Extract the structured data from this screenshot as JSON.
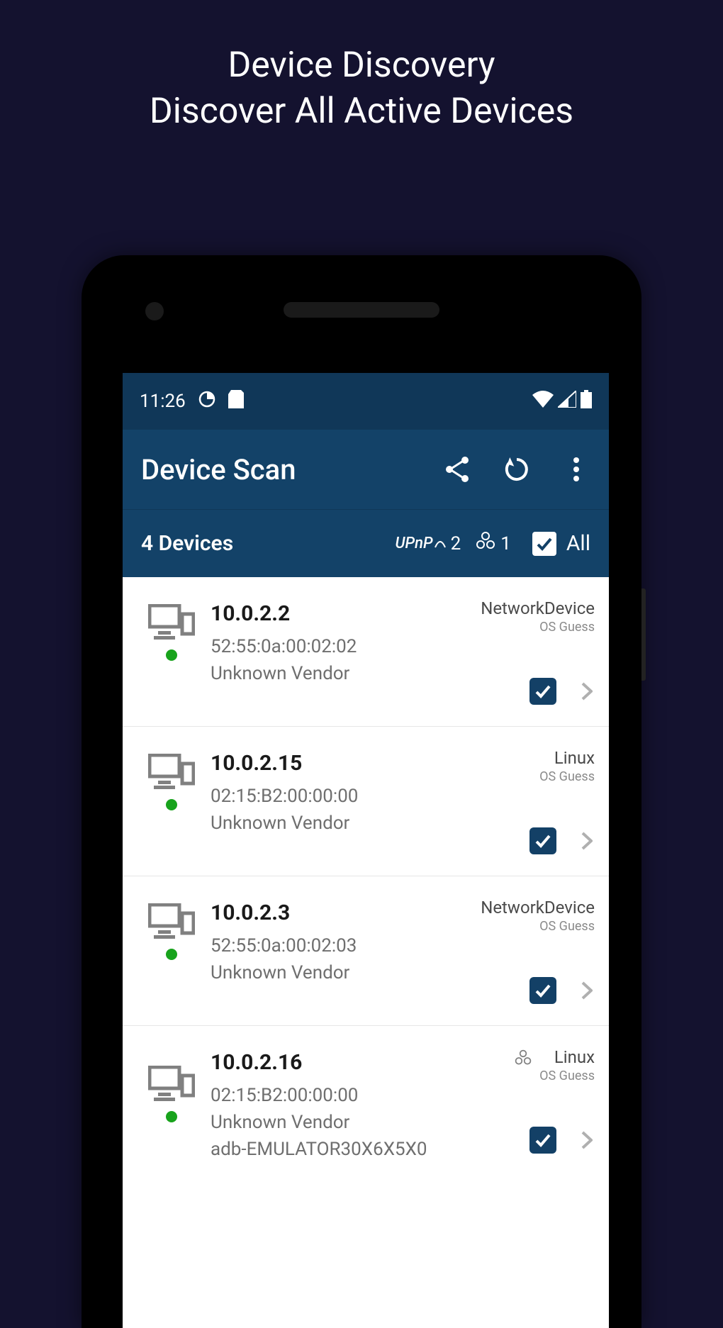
{
  "promo": {
    "line1": "Device Discovery",
    "line2": "Discover All Active Devices"
  },
  "statusbar": {
    "time": "11:26"
  },
  "appbar": {
    "title": "Device Scan"
  },
  "subbar": {
    "device_count_label": "4 Devices",
    "upnp_label": "UPnP",
    "upnp_count": "2",
    "bonjour_count": "1",
    "all_label": "All"
  },
  "devices": [
    {
      "ip": "10.0.2.2",
      "mac": "52:55:0a:00:02:02",
      "vendor": "Unknown Vendor",
      "os": "NetworkDevice",
      "os_sub": "OS Guess",
      "bonjour": false,
      "hostname": ""
    },
    {
      "ip": "10.0.2.15",
      "mac": "02:15:B2:00:00:00",
      "vendor": "Unknown Vendor",
      "os": "Linux",
      "os_sub": "OS Guess",
      "bonjour": false,
      "hostname": ""
    },
    {
      "ip": "10.0.2.3",
      "mac": "52:55:0a:00:02:03",
      "vendor": "Unknown Vendor",
      "os": "NetworkDevice",
      "os_sub": "OS Guess",
      "bonjour": false,
      "hostname": ""
    },
    {
      "ip": "10.0.2.16",
      "mac": "02:15:B2:00:00:00",
      "vendor": "Unknown Vendor",
      "os": "Linux",
      "os_sub": "OS Guess",
      "bonjour": true,
      "hostname": "adb-EMULATOR30X6X5X0"
    }
  ]
}
